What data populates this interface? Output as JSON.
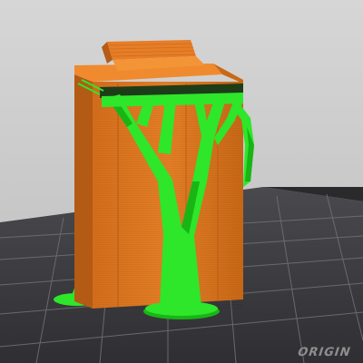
{
  "view": {
    "kind": "3D print preview with tree supports",
    "bed_label": "ORIGIN",
    "colors": {
      "background_top": "#d3d3d3",
      "background_bottom": "#bdbdbd",
      "bed": "#3a3a3d",
      "bed_grid": "#6b6b70",
      "model": "#e07a22",
      "model_dark": "#b25a14",
      "model_top": "#f08a2e",
      "support": "#2ee62a",
      "support_dark": "#18b515",
      "support_interface": "#1d3d18"
    }
  }
}
